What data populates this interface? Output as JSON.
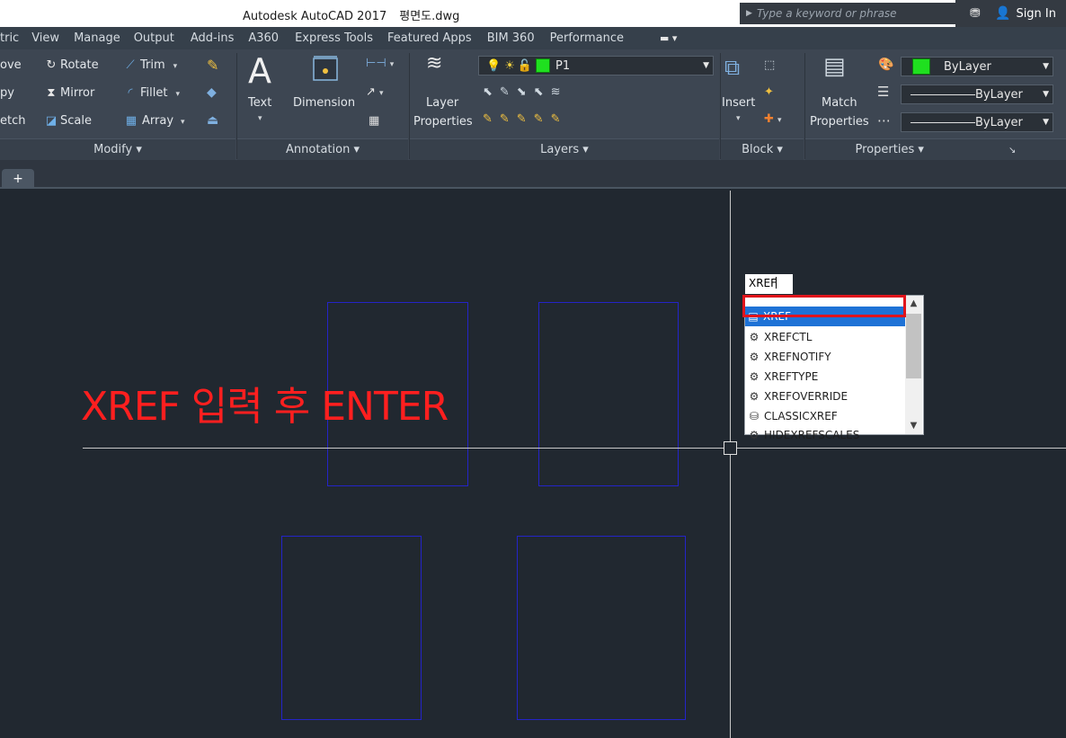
{
  "titlebar": {
    "app_title": "Autodesk AutoCAD 2017",
    "file_name": "평면도.dwg",
    "search_placeholder": "Type a keyword or phrase",
    "sign_in": "Sign In"
  },
  "menu": {
    "tabs": [
      "tric",
      "View",
      "Manage",
      "Output",
      "Add-ins",
      "A360",
      "Express Tools",
      "Featured Apps",
      "BIM 360",
      "Performance"
    ]
  },
  "ribbon": {
    "modify": {
      "left_cut": [
        "ove",
        "py",
        "etch"
      ],
      "rotate": "Rotate",
      "mirror": "Mirror",
      "scale": "Scale",
      "trim": "Trim",
      "fillet": "Fillet",
      "array": "Array",
      "panel_label": "Modify"
    },
    "annotation": {
      "text": "Text",
      "dimension": "Dimension",
      "panel_label": "Annotation"
    },
    "layers": {
      "layer_properties_1": "Layer",
      "layer_properties_2": "Properties",
      "current_layer": "P1",
      "panel_label": "Layers"
    },
    "block": {
      "insert": "Insert",
      "panel_label": "Block"
    },
    "properties": {
      "match_1": "Match",
      "match_2": "Properties",
      "color": "ByLayer",
      "lineweight": "ByLayer",
      "linetype": "ByLayer",
      "panel_label": "Properties"
    }
  },
  "canvas": {
    "annotation_text": "XREF 입력 후 ENTER",
    "command_input": "XREF"
  },
  "autocomplete": {
    "items": [
      {
        "label": "XREF",
        "icon": "xref-icon",
        "selected": true
      },
      {
        "label": "XREFCTL",
        "icon": "gear-icon"
      },
      {
        "label": "XREFNOTIFY",
        "icon": "gear-icon"
      },
      {
        "label": "XREFTYPE",
        "icon": "gear-icon"
      },
      {
        "label": "XREFOVERRIDE",
        "icon": "gear-icon"
      },
      {
        "label": "CLASSICXREF",
        "icon": "classic-xref-icon"
      },
      {
        "label": "HIDEXREFSCALES",
        "icon": "gear-icon"
      }
    ]
  },
  "colors": {
    "annotation": "#ff1f1f",
    "selection": "#1e72d6",
    "highlight_box": "#e0141c",
    "drawing_lines": "#2424c8"
  }
}
